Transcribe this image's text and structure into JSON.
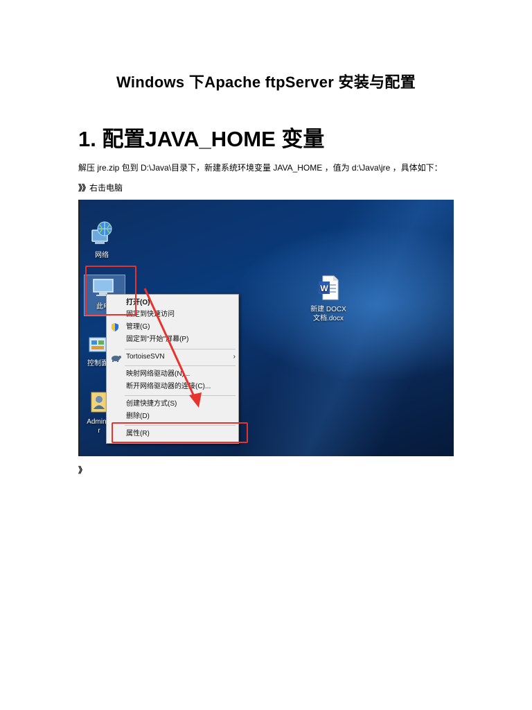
{
  "document": {
    "title": "Windows 下Apache ftpServer 安装与配置",
    "heading": "1. 配置JAVA_HOME 变量",
    "paragraph": "解压 jre.zip 包到 D:\\Java\\目录下，新建系统环境变量 JAVA_HOME ，值为 d:\\Java\\jre ，具体如下：",
    "step_mark": "》》",
    "step_text": "右击电脑",
    "end_mark": "》"
  },
  "screenshot": {
    "desktop_icons": [
      {
        "label": "网络",
        "icon": "network-icon"
      },
      {
        "label": "此电",
        "icon": "computer-icon"
      },
      {
        "label": "控制面",
        "icon": "control-panel-icon"
      },
      {
        "label": "Administrator",
        "label_lines": [
          "Adminis",
          "r"
        ],
        "icon": "user-folder-icon"
      },
      {
        "label_lines": [
          "新建 DOCX",
          "文档.docx"
        ],
        "icon": "word-doc-icon"
      }
    ],
    "context_menu": {
      "items": [
        {
          "label": "打开(O)",
          "bold": true
        },
        {
          "label": "固定到快速访问"
        },
        {
          "label": "管理(G)",
          "icon": "shield-icon"
        },
        {
          "label": "固定到\"开始\"屏幕(P)"
        },
        {
          "label": "TortoiseSVN",
          "icon": "tortoise-svn-icon",
          "submenu": "›"
        },
        {
          "label": "映射网络驱动器(N)..."
        },
        {
          "label": "断开网络驱动器的连接(C)..."
        },
        {
          "label": "创建快捷方式(S)"
        },
        {
          "label": "删除(D)"
        },
        {
          "label": "属性(R)"
        }
      ]
    },
    "colors": {
      "highlight": "#e8322d",
      "menu_bg": "#f0f0f0",
      "desktop": "#0a3a7a"
    }
  }
}
